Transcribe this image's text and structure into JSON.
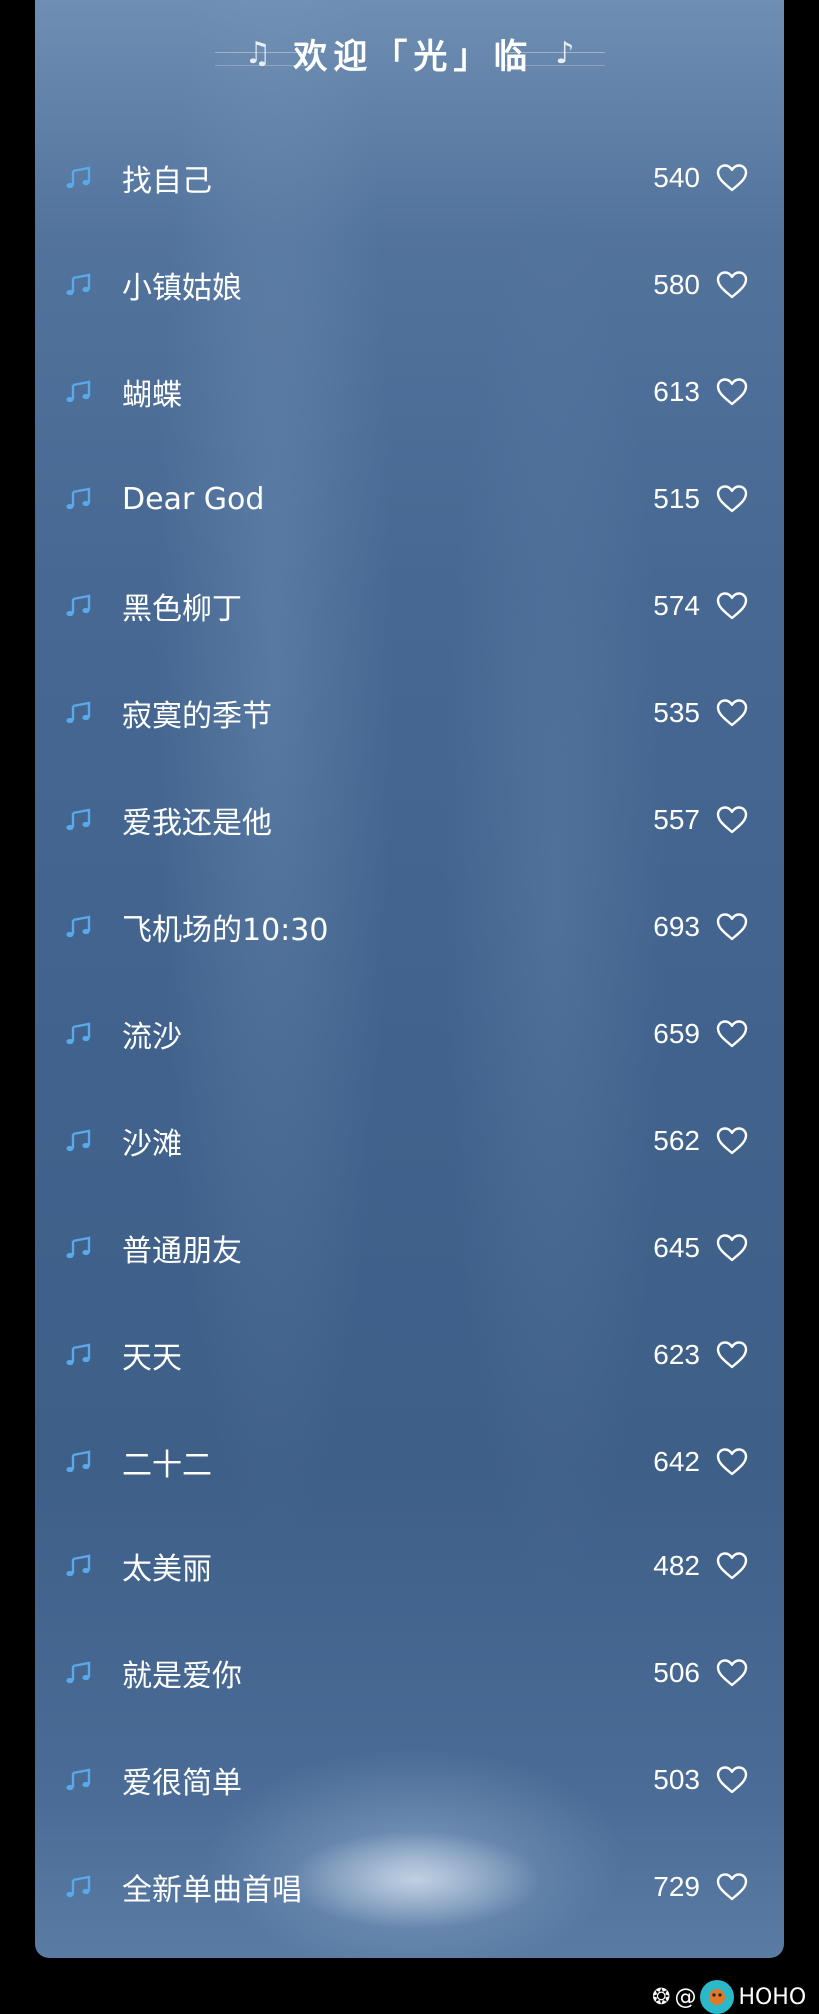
{
  "header": {
    "title": "欢迎「光」临"
  },
  "songs": [
    {
      "title": "找自己",
      "likes": "540"
    },
    {
      "title": "小镇姑娘",
      "likes": "580"
    },
    {
      "title": "蝴蝶",
      "likes": "613"
    },
    {
      "title": "Dear God",
      "likes": "515"
    },
    {
      "title": "黑色柳丁",
      "likes": "574"
    },
    {
      "title": "寂寞的季节",
      "likes": "535"
    },
    {
      "title": "爱我还是他",
      "likes": "557"
    },
    {
      "title": "飞机场的10:30",
      "likes": "693"
    },
    {
      "title": "流沙",
      "likes": "659"
    },
    {
      "title": "沙滩",
      "likes": "562"
    },
    {
      "title": "普通朋友",
      "likes": "645"
    },
    {
      "title": "天天",
      "likes": "623"
    },
    {
      "title": "二十二",
      "likes": "642"
    },
    {
      "title": "太美丽",
      "likes": "482"
    },
    {
      "title": "就是爱你",
      "likes": "506"
    },
    {
      "title": "爱很简单",
      "likes": "503"
    },
    {
      "title": "全新单曲首唱",
      "likes": "729"
    }
  ],
  "watermark": {
    "text": "@",
    "suffix": "HOHO"
  },
  "icons": {
    "row_icon": "music-note-icon",
    "like_icon": "heart-outline-icon"
  },
  "colors": {
    "note_accent": "#5aa9e8",
    "text": "#ffffff",
    "background": "#000000"
  }
}
